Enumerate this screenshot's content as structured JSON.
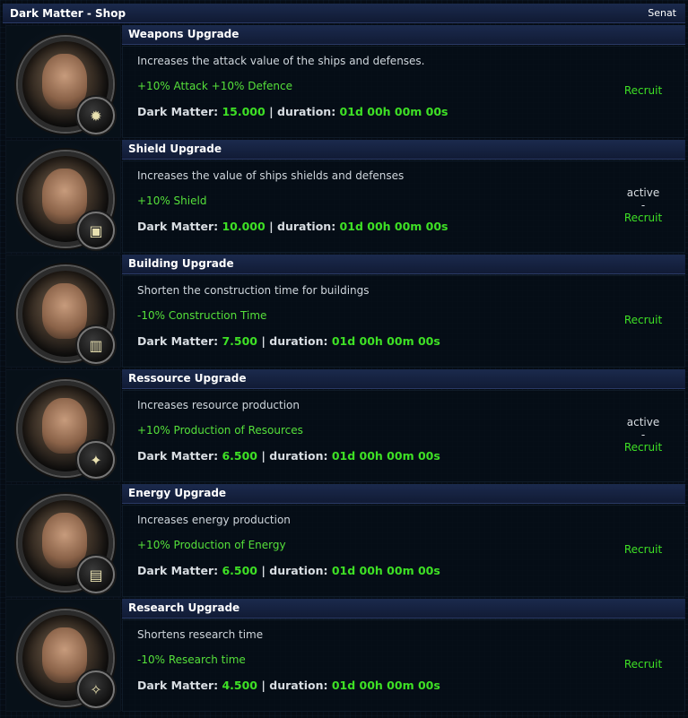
{
  "header": {
    "title": "Dark Matter - Shop",
    "right": "Senat"
  },
  "cost_label": "Dark Matter:",
  "duration_label": "| duration:",
  "items": [
    {
      "title": "Weapons Upgrade",
      "description": "Increases the attack value of the ships and defenses.",
      "bonus": "+10% Attack +10% Defence",
      "cost": "15.000",
      "duration": "01d 00h 00m 00s",
      "active": "",
      "dash": "",
      "recruit": "Recruit",
      "badge_icon": "star-badge-icon",
      "badge_glyph": "✹"
    },
    {
      "title": "Shield Upgrade",
      "description": "Increases the value of ships shields and defenses",
      "bonus": "+10% Shield",
      "cost": "10.000",
      "duration": "01d 00h 00m 00s",
      "active": "active",
      "dash": "-",
      "recruit": "Recruit",
      "badge_icon": "shield-badge-icon",
      "badge_glyph": "▣"
    },
    {
      "title": "Building Upgrade",
      "description": "Shorten the construction time for buildings",
      "bonus": "-10% Construction Time",
      "cost": "7.500",
      "duration": "01d 00h 00m 00s",
      "active": "",
      "dash": "",
      "recruit": "Recruit",
      "badge_icon": "building-badge-icon",
      "badge_glyph": "▥"
    },
    {
      "title": "Ressource Upgrade",
      "description": "Increases resource production",
      "bonus": "+10% Production of Resources",
      "cost": "6.500",
      "duration": "01d 00h 00m 00s",
      "active": "active",
      "dash": "-",
      "recruit": "Recruit",
      "badge_icon": "resource-badge-icon",
      "badge_glyph": "✦"
    },
    {
      "title": "Energy Upgrade",
      "description": "Increases energy production",
      "bonus": "+10% Production of Energy",
      "cost": "6.500",
      "duration": "01d 00h 00m 00s",
      "active": "",
      "dash": "",
      "recruit": "Recruit",
      "badge_icon": "energy-badge-icon",
      "badge_glyph": "▤"
    },
    {
      "title": "Research Upgrade",
      "description": "Shortens research time",
      "bonus": "-10% Research time",
      "cost": "4.500",
      "duration": "01d 00h 00m 00s",
      "active": "",
      "dash": "",
      "recruit": "Recruit",
      "badge_icon": "research-badge-icon",
      "badge_glyph": "✧"
    }
  ]
}
